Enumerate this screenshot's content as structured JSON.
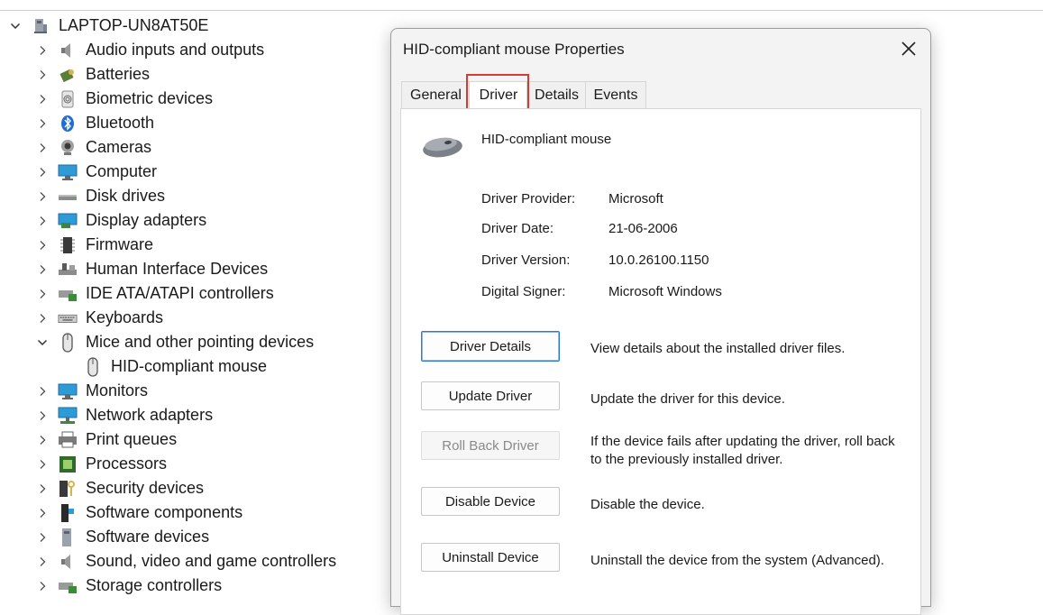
{
  "tree": {
    "root": "LAPTOP-UN8AT50E",
    "items": [
      {
        "label": "Audio inputs and outputs",
        "icon": "speaker-icon"
      },
      {
        "label": "Batteries",
        "icon": "battery-icon"
      },
      {
        "label": "Biometric devices",
        "icon": "fingerprint-icon"
      },
      {
        "label": "Bluetooth",
        "icon": "bluetooth-icon"
      },
      {
        "label": "Cameras",
        "icon": "camera-icon"
      },
      {
        "label": "Computer",
        "icon": "monitor-icon"
      },
      {
        "label": "Disk drives",
        "icon": "disk-icon"
      },
      {
        "label": "Display adapters",
        "icon": "display-adapter-icon"
      },
      {
        "label": "Firmware",
        "icon": "chip-icon"
      },
      {
        "label": "Human Interface Devices",
        "icon": "hid-icon"
      },
      {
        "label": "IDE ATA/ATAPI controllers",
        "icon": "ide-icon"
      },
      {
        "label": "Keyboards",
        "icon": "keyboard-icon"
      },
      {
        "label": "Mice and other pointing devices",
        "icon": "mouse-icon"
      },
      {
        "label": "HID-compliant mouse",
        "icon": "mouse-icon"
      },
      {
        "label": "Monitors",
        "icon": "monitor-icon"
      },
      {
        "label": "Network adapters",
        "icon": "network-icon"
      },
      {
        "label": "Print queues",
        "icon": "printer-icon"
      },
      {
        "label": "Processors",
        "icon": "processor-icon"
      },
      {
        "label": "Security devices",
        "icon": "security-icon"
      },
      {
        "label": "Software components",
        "icon": "software-component-icon"
      },
      {
        "label": "Software devices",
        "icon": "software-device-icon"
      },
      {
        "label": "Sound, video and game controllers",
        "icon": "speaker-icon"
      },
      {
        "label": "Storage controllers",
        "icon": "storage-icon"
      }
    ]
  },
  "dialog": {
    "title": "HID-compliant mouse Properties",
    "tabs": [
      "General",
      "Driver",
      "Details",
      "Events"
    ],
    "active_tab": "Driver",
    "device_name": "HID-compliant mouse",
    "props": [
      {
        "label": "Driver Provider:",
        "value": "Microsoft"
      },
      {
        "label": "Driver Date:",
        "value": "21-06-2006"
      },
      {
        "label": "Driver Version:",
        "value": "10.0.26100.1150"
      },
      {
        "label": "Digital Signer:",
        "value": "Microsoft Windows"
      }
    ],
    "actions": [
      {
        "button": "Driver Details",
        "desc": "View details about the installed driver files."
      },
      {
        "button": "Update Driver",
        "desc": "Update the driver for this device."
      },
      {
        "button": "Roll Back Driver",
        "desc": "If the device fails after updating the driver, roll back to the previously installed driver."
      },
      {
        "button": "Disable Device",
        "desc": "Disable the device."
      },
      {
        "button": "Uninstall Device",
        "desc": "Uninstall the device from the system (Advanced)."
      }
    ]
  },
  "colors": {
    "highlight": "#d63b31",
    "accent": "#2d7ad6"
  }
}
